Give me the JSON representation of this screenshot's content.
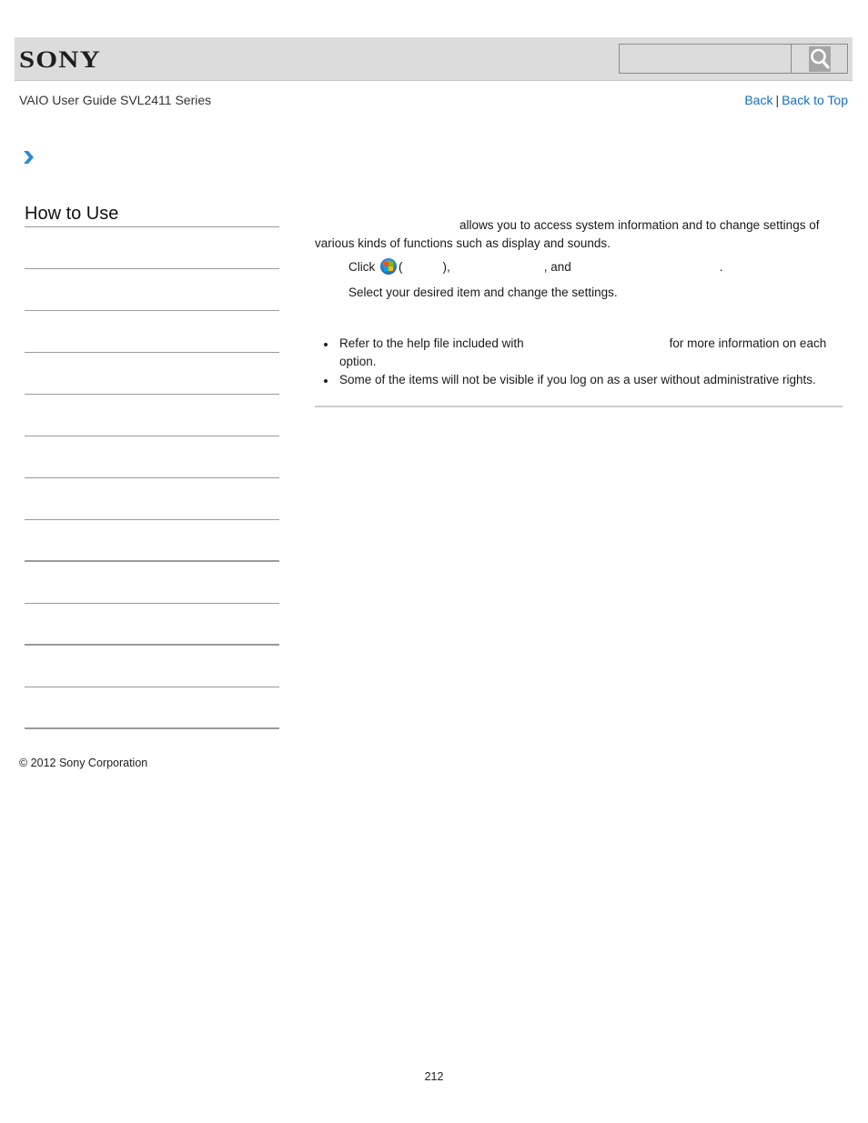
{
  "header": {
    "logo": "SONY",
    "search": {
      "value": "",
      "placeholder": ""
    },
    "search_button_icon": "search-icon"
  },
  "subheader": {
    "guide_title": "VAIO User Guide SVL2411 Series",
    "back_label": "Back",
    "separator": "|",
    "back_to_top_label": "Back to Top"
  },
  "breadcrumb": {
    "icon": "chevron-right-icon",
    "color": "#2a8ad4"
  },
  "sidebar": {
    "title": "How to Use",
    "items": [
      {
        "label": ""
      },
      {
        "label": ""
      },
      {
        "label": ""
      },
      {
        "label": ""
      },
      {
        "label": ""
      },
      {
        "label": ""
      },
      {
        "label": ""
      },
      {
        "label": ""
      },
      {
        "label": ""
      },
      {
        "label": ""
      },
      {
        "label": ""
      },
      {
        "label": ""
      }
    ]
  },
  "content": {
    "intro_line1": "allows you to access system information and to change settings of",
    "intro_line2": "various kinds of functions such as display and sounds.",
    "step1": {
      "click": "Click",
      "start_icon": "windows-start-icon",
      "open_paren": "(",
      "close_paren": "),",
      "and": ", and",
      "period": "."
    },
    "step2": "Select your desired item and change the settings.",
    "notes": [
      {
        "before": "Refer to the help file included with",
        "after": "for more information on each option."
      },
      {
        "text": "Some of the items will not be visible if you log on as a user without administrative rights."
      }
    ]
  },
  "footer": {
    "copyright": "© 2012 Sony Corporation",
    "page_number": "212"
  },
  "colors": {
    "header_bg": "#dcdcdc",
    "link": "#1470c4",
    "accent": "#2a8ad4",
    "divider": "#cccccc",
    "sidebar_rule": "#9a9a9a"
  }
}
